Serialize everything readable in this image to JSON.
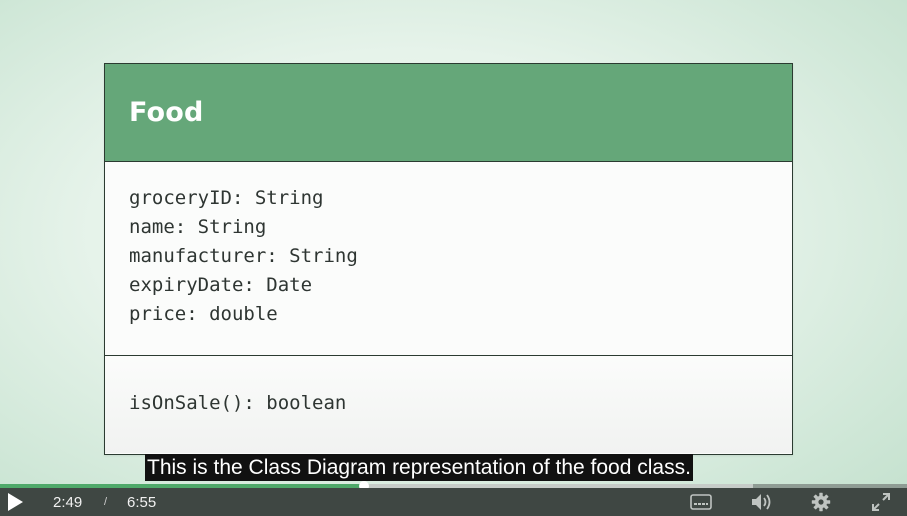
{
  "slide": {
    "class_name": "Food",
    "attributes": [
      "groceryID: String",
      "name: String",
      "manufacturer: String",
      "expiryDate: Date",
      "price: double"
    ],
    "methods": [
      "isOnSale(): boolean"
    ]
  },
  "caption": "This is the Class Diagram representation of the food class.",
  "player": {
    "current_time": "2:49",
    "separator": "/",
    "total_time": "6:55",
    "progress_played": 0.401,
    "progress_buffered": 0.83,
    "icons": [
      "play-icon",
      "captions-icon",
      "volume-icon",
      "settings-icon",
      "fullscreen-icon"
    ],
    "colors": {
      "played": "#4fa96a",
      "control_bar": "#3f4743",
      "header": "#65a779"
    }
  }
}
